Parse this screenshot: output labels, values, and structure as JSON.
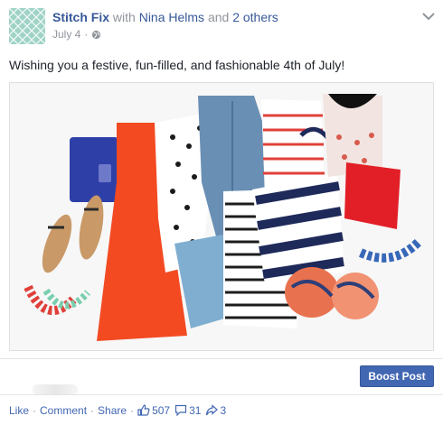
{
  "post": {
    "page_name": "Stitch Fix",
    "with_text": "with",
    "tagged_person": "Nina Helms",
    "and_text": "and",
    "others_link": "2 others",
    "date": "July 4",
    "dot": "·",
    "message": "Wishing you a festive, fun-filled, and fashionable 4th of July!",
    "audience_icon": "globe-icon",
    "menu_icon": "chevron-down-icon"
  },
  "photo": {
    "items": [
      "blue clutch",
      "sandals",
      "coral necklace",
      "mint necklace",
      "orange dress",
      "polka dot blouse",
      "denim jacket",
      "denim shorts",
      "striped top",
      "striped tote bag",
      "patterned top",
      "red shorts",
      "blue necklace",
      "printed scarf"
    ]
  },
  "boost": {
    "button_label": "Boost Post"
  },
  "actions": {
    "like": "Like",
    "comment": "Comment",
    "share": "Share",
    "sep": "·",
    "likes_count": "507",
    "comments_count": "31",
    "shares_count": "3"
  },
  "colors": {
    "link_blue": "#365899",
    "button_blue": "#4267b2",
    "muted_gray": "#90949c",
    "brand_mint": "#9fd3c6"
  }
}
